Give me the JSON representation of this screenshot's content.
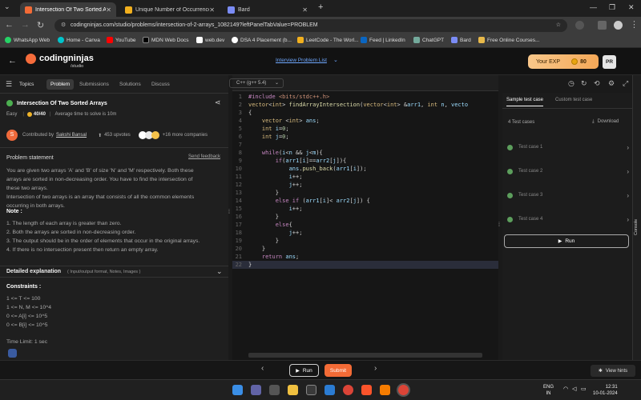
{
  "browser": {
    "tabs": [
      {
        "title": "Intersection Of Two Sorted Arra",
        "active": true
      },
      {
        "title": "Unique Number of Occurrences",
        "active": false
      },
      {
        "title": "Bard",
        "active": false
      }
    ],
    "new_tab": "+",
    "url": "codingninjas.com/studio/problems/intersection-of-2-arrays_1082149?leftPanelTabValue=PROBLEM",
    "bookmarks": [
      "WhatsApp Web",
      "Home - Canva",
      "YouTube",
      "MDN Web Docs",
      "web.dev",
      "DSA 4 Placement (b...",
      "LeetCode - The Worl...",
      "Feed | LinkedIn",
      "ChatGPT",
      "Bard",
      "Free Online Courses..."
    ]
  },
  "header": {
    "logo_text": "codingninjas",
    "logo_sub": "/studio",
    "interview_link": "Interview Problem List",
    "exp_label": "Your EXP",
    "exp_value": "80",
    "avatar": "PR"
  },
  "left": {
    "tabs": [
      "Topics",
      "Problem",
      "Submissions",
      "Solutions",
      "Discuss"
    ],
    "title": "Intersection Of Two Sorted Arrays",
    "difficulty": "Easy",
    "score": "40/40",
    "avg_time": "Average time to solve is 10m",
    "contributor_prefix": "Contributed by",
    "contributor": "Sakshi Bansal",
    "upvotes": "453 upvotes",
    "companies": "+16 more companies",
    "statement_heading": "Problem statement",
    "send_feedback": "Send feedback",
    "statement_lines": [
      "You are given two arrays 'A' and 'B' of size 'N' and 'M' respectively. Both these",
      "arrays are sorted in non-decreasing order. You have to find the intersection of",
      "these two arrays.",
      "Intersection of two arrays is an array that consists of all the common elements",
      "occurring in both arrays."
    ],
    "note_heading": "Note :",
    "notes": [
      "1. The length of each array is greater than zero.",
      "2. Both the arrays are sorted in non-decreasing order.",
      "3. The output should be in the order of elements that occur in the original arrays.",
      "4. If there is no intersection present then return an empty array."
    ],
    "detailed_heading": "Detailed explanation",
    "detailed_sub": "( Input/output format, Notes, Images )",
    "constraints_heading": "Constraints :",
    "constraints": [
      "1 <= T <= 100",
      "1 <= N, M <= 10^4",
      "0 <= A[i] <= 10^5",
      "0 <= B[i] <= 10^5"
    ],
    "time_limit": "Time Limit: 1 sec"
  },
  "editor": {
    "language": "C++ (g++ 5.4)",
    "line_count": 22
  },
  "right": {
    "tabs": [
      "Sample test case",
      "Custom test case"
    ],
    "test_count": "4 Test cases",
    "download": "Download",
    "test_cases": [
      "Test case 1",
      "Test case 2",
      "Test case 3",
      "Test case 4"
    ],
    "run": "Run",
    "console": "Console"
  },
  "bottom": {
    "run": "Run",
    "submit": "Submit",
    "hints": "View hints"
  },
  "taskbar": {
    "lang": "ENG",
    "region": "IN",
    "time": "12:31",
    "date": "10-01-2024"
  },
  "colors": {
    "accent": "#f36b36",
    "link": "#6fa8ff",
    "success": "#4caf50"
  }
}
